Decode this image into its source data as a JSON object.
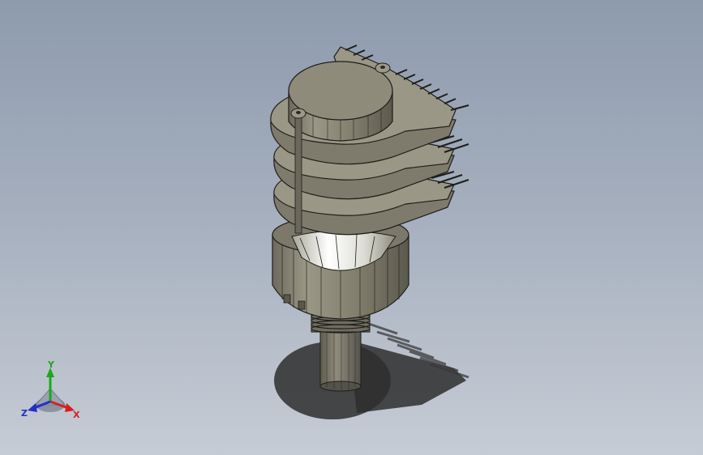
{
  "model": {
    "name": "rotary-switch-3-deck",
    "body_color": "#8a8778",
    "edge_color": "#1e1e1a",
    "highlight_color": "#f2f2ee",
    "shadow_color": "#2a2a2a"
  },
  "triad": {
    "x_label": "X",
    "y_label": "Y",
    "z_label": "Z",
    "x_color": "#d62020",
    "y_color": "#1aa81a",
    "z_color": "#2030c8"
  }
}
